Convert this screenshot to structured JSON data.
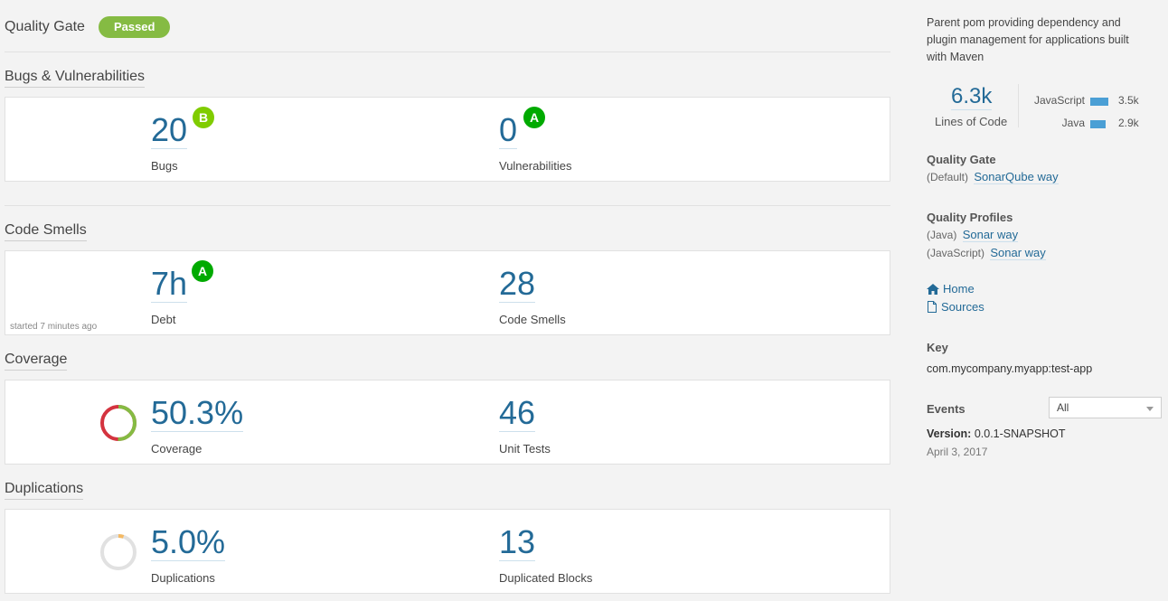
{
  "quality_gate": {
    "title": "Quality Gate",
    "status": "Passed",
    "status_color": "#85bb43"
  },
  "sections": {
    "bugs": {
      "title": "Bugs & Vulnerabilities",
      "bugs": {
        "value": "20",
        "label": "Bugs",
        "rating": "B"
      },
      "vulnerabilities": {
        "value": "0",
        "label": "Vulnerabilities",
        "rating": "A"
      }
    },
    "smells": {
      "title": "Code Smells",
      "debt": {
        "value": "7h",
        "label": "Debt",
        "rating": "A"
      },
      "smells": {
        "value": "28",
        "label": "Code Smells"
      },
      "started": "started 7 minutes ago"
    },
    "coverage": {
      "title": "Coverage",
      "coverage": {
        "value": "50.3%",
        "label": "Coverage",
        "fraction": 0.503
      },
      "tests": {
        "value": "46",
        "label": "Unit Tests"
      }
    },
    "duplications": {
      "title": "Duplications",
      "duplications": {
        "value": "5.0%",
        "label": "Duplications",
        "fraction": 0.05
      },
      "blocks": {
        "value": "13",
        "label": "Duplicated Blocks"
      }
    }
  },
  "sidebar": {
    "description": "Parent pom providing dependency and plugin management for applications built with Maven",
    "loc": {
      "value": "6.3k",
      "label": "Lines of Code"
    },
    "languages": [
      {
        "name": "JavaScript",
        "value": "3.5k",
        "lines": 3.5
      },
      {
        "name": "Java",
        "value": "2.9k",
        "lines": 2.9
      }
    ],
    "quality_gate": {
      "title": "Quality Gate",
      "prefix": "(Default)",
      "link": "SonarQube way"
    },
    "quality_profiles": {
      "title": "Quality Profiles",
      "items": [
        {
          "lang": "(Java)",
          "link": "Sonar way"
        },
        {
          "lang": "(JavaScript)",
          "link": "Sonar way"
        }
      ]
    },
    "links": {
      "home": "Home",
      "sources": "Sources"
    },
    "key": {
      "title": "Key",
      "value": "com.mycompany.myapp:test-app"
    },
    "events": {
      "title": "Events",
      "filter": "All",
      "version_label": "Version:",
      "version": "0.0.1-SNAPSHOT",
      "date": "April 3, 2017"
    }
  },
  "colors": {
    "link": "#236a97",
    "rating_a": "#00aa00",
    "rating_b": "#80cc00",
    "coverage_good": "#85bb43",
    "coverage_bad": "#d4333f",
    "dup_fill": "#f4b963",
    "lang_bar": "#4b9fd5"
  },
  "icons": [
    "home-icon",
    "file-icon",
    "chevron-down-icon"
  ]
}
